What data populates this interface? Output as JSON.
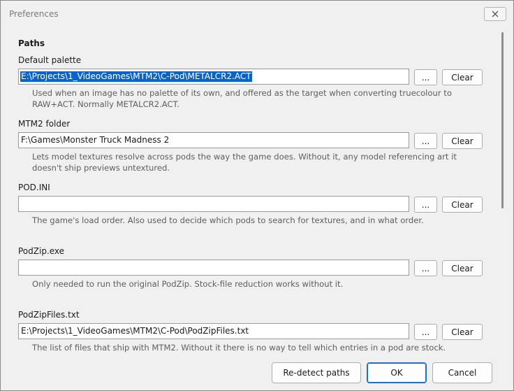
{
  "window": {
    "title": "Preferences"
  },
  "section": {
    "heading": "Paths"
  },
  "fields": [
    {
      "label": "Default palette",
      "value": "E:\\Projects\\1_VideoGames\\MTM2\\C-Pod\\METALCR2.ACT",
      "selected": true,
      "browse_label": "...",
      "clear_label": "Clear",
      "hint": "Used when an image has no palette of its own, and offered as the target when converting truecolour to RAW+ACT. Normally METALCR2.ACT."
    },
    {
      "label": "MTM2 folder",
      "value": "F:\\Games\\Monster Truck Madness 2",
      "selected": false,
      "browse_label": "...",
      "clear_label": "Clear",
      "hint": "Lets model textures resolve across pods the way the game does. Without it, any model referencing art it doesn't ship previews untextured."
    },
    {
      "label": "POD.INI",
      "value": "",
      "selected": false,
      "browse_label": "...",
      "clear_label": "Clear",
      "hint": "The game's load order. Also used to decide which pods to search for textures, and in what order."
    },
    {
      "label": "PodZip.exe",
      "value": "",
      "selected": false,
      "browse_label": "...",
      "clear_label": "Clear",
      "hint": "Only needed to run the original PodZip. Stock-file reduction works without it."
    },
    {
      "label": "PodZipFiles.txt",
      "value": "E:\\Projects\\1_VideoGames\\MTM2\\C-Pod\\PodZipFiles.txt",
      "selected": false,
      "browse_label": "...",
      "clear_label": "Clear",
      "hint": "The list of files that ship with MTM2. Without it there is no way to tell which entries in a pod are stock."
    }
  ],
  "footer": {
    "redetect_label": "Re-detect paths",
    "ok_label": "OK",
    "cancel_label": "Cancel"
  },
  "colors": {
    "selection": "#0a64c8",
    "primary_border": "#1f6fc9"
  }
}
